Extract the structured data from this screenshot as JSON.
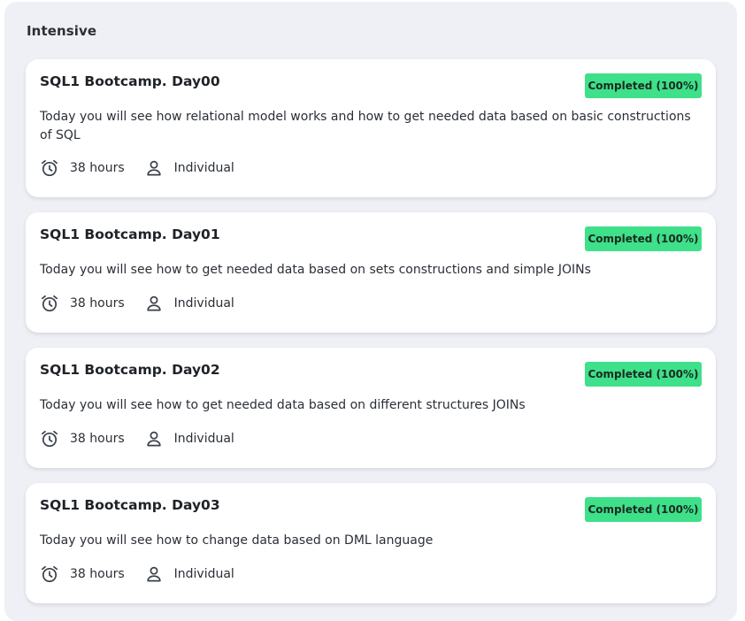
{
  "section": {
    "title": "Intensive"
  },
  "colors": {
    "badge": "#3ee089",
    "panel": "#eef0f5",
    "card": "#ffffff"
  },
  "cards": [
    {
      "title": "SQL1 Bootcamp. Day00",
      "badge": "Completed (100%)",
      "progress": 100,
      "description": "Today you will see how relational model works and how to get needed data based on basic constructions of SQL",
      "duration": "38 hours",
      "duration_icon": "alarm-clock-icon",
      "type": "Individual",
      "type_icon": "person-icon"
    },
    {
      "title": "SQL1 Bootcamp. Day01",
      "badge": "Completed (100%)",
      "progress": 100,
      "description": "Today you will see how to get needed data based on sets constructions and simple JOINs",
      "duration": "38 hours",
      "duration_icon": "alarm-clock-icon",
      "type": "Individual",
      "type_icon": "person-icon"
    },
    {
      "title": "SQL1 Bootcamp. Day02",
      "badge": "Completed (100%)",
      "progress": 100,
      "description": "Today you will see how to get needed data based on different structures JOINs",
      "duration": "38 hours",
      "duration_icon": "alarm-clock-icon",
      "type": "Individual",
      "type_icon": "person-icon"
    },
    {
      "title": "SQL1 Bootcamp. Day03",
      "badge": "Completed (100%)",
      "progress": 100,
      "description": "Today you will see how to change data based on DML language",
      "duration": "38 hours",
      "duration_icon": "alarm-clock-icon",
      "type": "Individual",
      "type_icon": "person-icon"
    }
  ]
}
